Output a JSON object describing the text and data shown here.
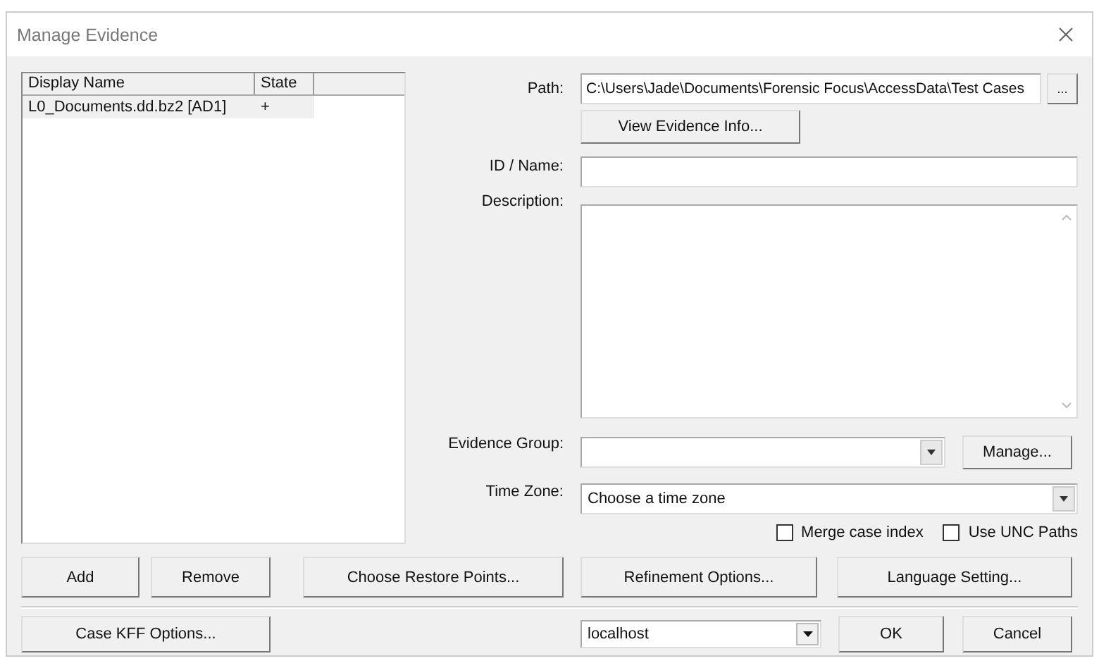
{
  "window": {
    "title": "Manage Evidence"
  },
  "evidence_list": {
    "columns": [
      "Display Name",
      "State"
    ],
    "rows": [
      {
        "cells": [
          "L0_Documents.dd.bz2 [AD1]",
          "+"
        ],
        "selected": true
      }
    ]
  },
  "path": {
    "label": "Path:",
    "value": "C:\\Users\\Jade\\Documents\\Forensic Focus\\AccessData\\Test Cases",
    "browse": "..."
  },
  "view_info_button": "View Evidence Info...",
  "id_name": {
    "label": "ID / Name:"
  },
  "description": {
    "label": "Description:"
  },
  "evidence_group": {
    "label": "Evidence Group:",
    "manage": "Manage..."
  },
  "time_zone": {
    "label": "Time Zone:",
    "value": "Choose a time zone"
  },
  "options": [
    {
      "label": "Merge case index",
      "checked": false
    },
    {
      "label": "Use UNC Paths",
      "checked": false
    }
  ],
  "list_buttons": [
    "Add",
    "Remove",
    "Choose Restore Points..."
  ],
  "action_buttons": [
    "Refinement Options...",
    "Language Setting..."
  ],
  "kff_button": "Case KFF Options...",
  "server": {
    "value": "localhost"
  },
  "dialog_buttons": [
    "OK",
    "Cancel"
  ]
}
